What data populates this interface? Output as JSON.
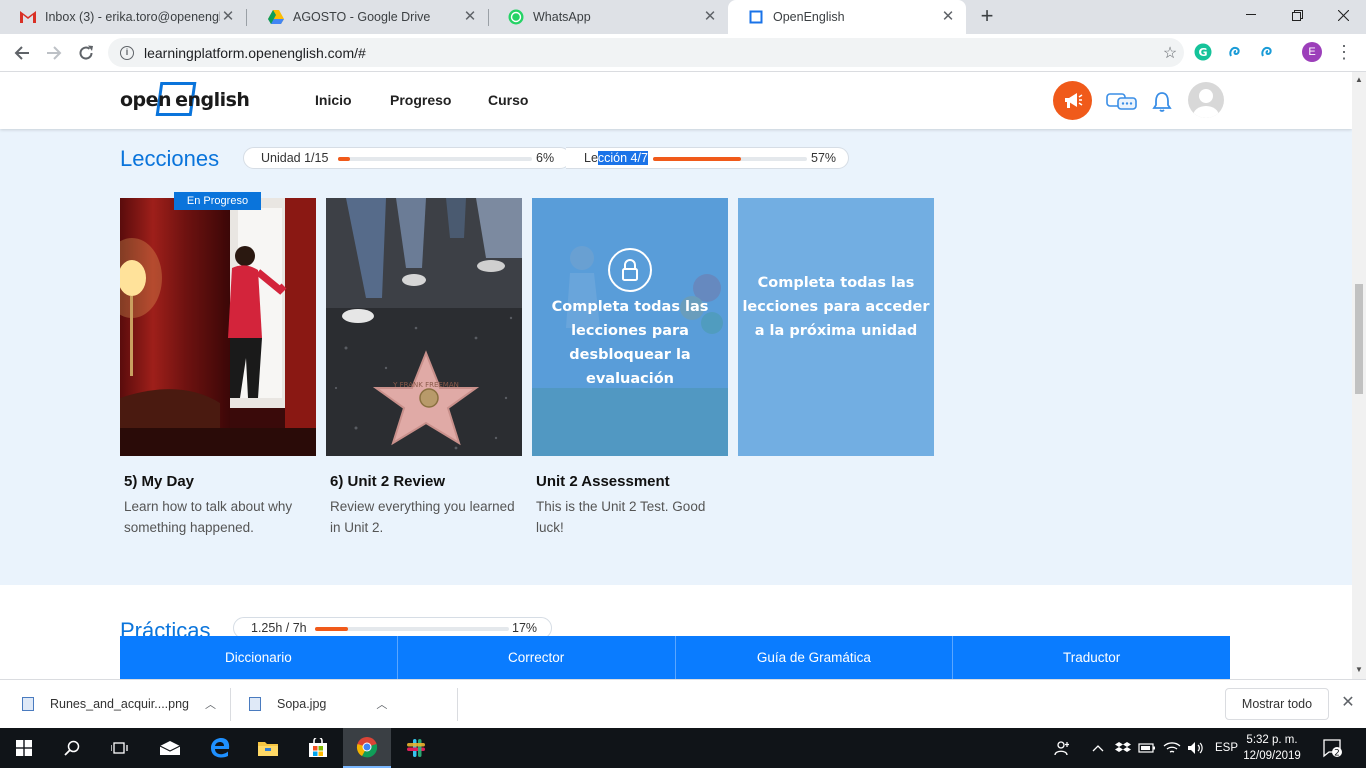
{
  "browser": {
    "tabs": [
      {
        "title": "Inbox (3) - erika.toro@openengli",
        "icon": "gmail-icon"
      },
      {
        "title": "AGOSTO - Google Drive",
        "icon": "drive-icon"
      },
      {
        "title": "WhatsApp",
        "icon": "whatsapp-icon"
      },
      {
        "title": "OpenEnglish",
        "icon": "openenglish-icon"
      }
    ],
    "url": "learningplatform.openenglish.com/#",
    "profile_initial": "E"
  },
  "site": {
    "logo_left": "open",
    "logo_right": "english",
    "nav": [
      "Inicio",
      "Progreso",
      "Curso"
    ]
  },
  "lessons": {
    "title": "Lecciones",
    "unit_progress": {
      "label": "Unidad 1/15",
      "percent_text": "6%",
      "value": 0.06
    },
    "lesson_progress": {
      "label_pre": "Le",
      "label_sel": "cción 4/7",
      "percent_text": "57%",
      "value": 0.57
    },
    "in_progress_badge": "En Progreso",
    "cards": [
      {
        "title": "5) My Day",
        "desc": "Learn how to talk about why something happened."
      },
      {
        "title": "6) Unit 2 Review",
        "desc": "Review everything you learned in Unit 2."
      },
      {
        "title": "Unit 2 Assessment",
        "desc": "This is the Unit 2 Test. Good luck!",
        "lock_text": "Completa todas las lecciones para desbloquear la evaluación"
      },
      {
        "lock_text": "Completa todas las lecciones para acceder a la próxima unidad"
      }
    ]
  },
  "practicas": {
    "title": "Prácticas",
    "progress": {
      "label": "1.25h / 7h",
      "percent_text": "17%",
      "value": 0.17
    }
  },
  "tools": [
    "Diccionario",
    "Corrector",
    "Guía de Gramática",
    "Traductor"
  ],
  "downloads": {
    "items": [
      "Runes_and_acquir....png",
      "Sopa.jpg"
    ],
    "show_all": "Mostrar todo"
  },
  "taskbar": {
    "lang": "ESP",
    "time": "5:32 p. m.",
    "date": "12/09/2019",
    "notifications": "2"
  },
  "colors": {
    "accent": "#0a74db",
    "progress": "#f05a1a",
    "lessons_bg": "#eaf3fc"
  }
}
